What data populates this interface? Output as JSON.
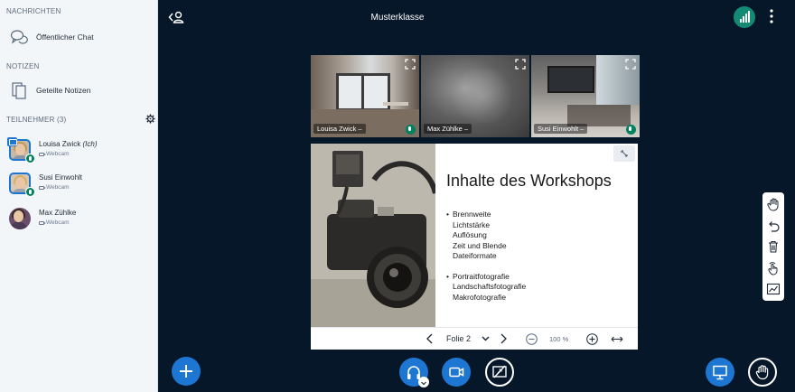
{
  "sidebar": {
    "messages_title": "NACHRICHTEN",
    "public_chat": "Öffentlicher Chat",
    "notes_title": "NOTIZEN",
    "shared_notes": "Geteilte Notizen",
    "participants_title": "TEILNEHMER (3)",
    "users": [
      {
        "name": "Louisa Zwick",
        "self": "(Ich)",
        "status": "Webcam"
      },
      {
        "name": "Susi Einwohlt",
        "status": "Webcam"
      },
      {
        "name": "Max Zühlke",
        "status": "Webcam"
      }
    ]
  },
  "header": {
    "title": "Musterklasse"
  },
  "webcams": [
    {
      "label": "Louisa Zwick –"
    },
    {
      "label": "Max Zühlke –"
    },
    {
      "label": "Susi Einwohlt –"
    }
  ],
  "presentation": {
    "title": "Inhalte des Workshops",
    "groups": [
      [
        "Brennweite",
        "Lichtstärke",
        "Auflösung",
        "Zeit und Blende",
        "Dateiformate"
      ],
      [
        "Portraitfotografie",
        "Landschaftsfotografie",
        "Makrofotografie"
      ]
    ],
    "slide_selector": "Folie 2",
    "zoom": "100 %"
  },
  "colors": {
    "background": "#06172a",
    "accent": "#1d76d2",
    "talking": "#00825f",
    "connection": "#138a73"
  }
}
